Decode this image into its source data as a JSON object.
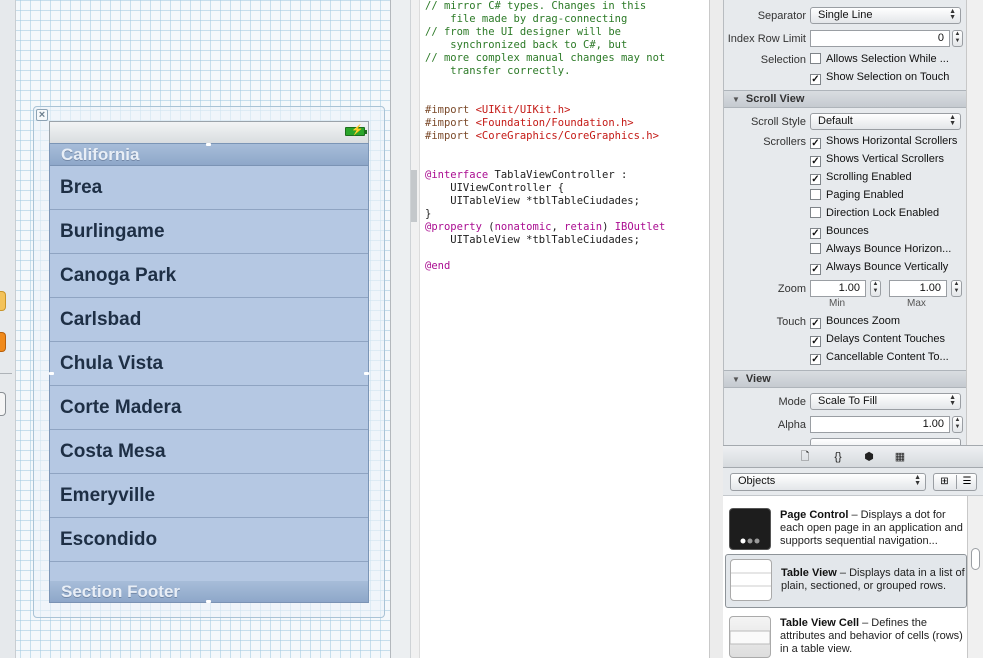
{
  "canvas": {
    "table": {
      "section_header": "California",
      "cells": [
        "Brea",
        "Burlingame",
        "Canoga Park",
        "Carlsbad",
        "Chula Vista",
        "Corte Madera",
        "Costa Mesa",
        "Emeryville",
        "Escondido"
      ],
      "section_footer": "Section Footer"
    },
    "close_glyph": "×",
    "battery_glyph": "⚡"
  },
  "code": {
    "lines": [
      [
        {
          "t": "// mirror C# types. Changes in this",
          "c": "comment"
        }
      ],
      [
        {
          "t": "    file made by drag-connecting",
          "c": "comment"
        }
      ],
      [
        {
          "t": "// from the UI designer will be",
          "c": "comment"
        }
      ],
      [
        {
          "t": "    synchronized back to C#, but",
          "c": "comment"
        }
      ],
      [
        {
          "t": "// more complex manual changes may not",
          "c": "comment"
        }
      ],
      [
        {
          "t": "    transfer correctly.",
          "c": "comment"
        }
      ],
      [
        {
          "t": "",
          "c": ""
        }
      ],
      [
        {
          "t": "",
          "c": ""
        }
      ],
      [
        {
          "t": "#import ",
          "c": "pre"
        },
        {
          "t": "<UIKit/UIKit.h>",
          "c": "str"
        }
      ],
      [
        {
          "t": "#import ",
          "c": "pre"
        },
        {
          "t": "<Foundation/Foundation.h>",
          "c": "str"
        }
      ],
      [
        {
          "t": "#import ",
          "c": "pre"
        },
        {
          "t": "<CoreGraphics/CoreGraphics.h>",
          "c": "str"
        }
      ],
      [
        {
          "t": "",
          "c": ""
        }
      ],
      [
        {
          "t": "",
          "c": ""
        }
      ],
      [
        {
          "t": "@interface",
          "c": "kw"
        },
        {
          "t": " TablaViewController :",
          "c": ""
        }
      ],
      [
        {
          "t": "    UIViewController {",
          "c": ""
        }
      ],
      [
        {
          "t": "    UITableView *tblTableCiudades;",
          "c": ""
        }
      ],
      [
        {
          "t": "}",
          "c": ""
        }
      ],
      [
        {
          "t": "@property",
          "c": "kw"
        },
        {
          "t": " (",
          "c": ""
        },
        {
          "t": "nonatomic",
          "c": "kw"
        },
        {
          "t": ", ",
          "c": ""
        },
        {
          "t": "retain",
          "c": "kw"
        },
        {
          "t": ") ",
          "c": ""
        },
        {
          "t": "IBOutlet",
          "c": "kw"
        }
      ],
      [
        {
          "t": "    UITableView *tblTableCiudades;",
          "c": ""
        }
      ],
      [
        {
          "t": "",
          "c": ""
        }
      ],
      [
        {
          "t": "@end",
          "c": "kw"
        }
      ]
    ]
  },
  "inspector": {
    "table_view": {
      "separator_label": "Separator",
      "separator_value": "Single Line",
      "index_row_limit_label": "Index Row Limit",
      "index_row_limit_value": "0",
      "selection_label": "Selection",
      "allows_selection_while": "Allows Selection While ...",
      "show_selection_on_touch": "Show Selection on Touch"
    },
    "scroll_view": {
      "title": "Scroll View",
      "scroll_style_label": "Scroll Style",
      "scroll_style_value": "Default",
      "scrollers_label": "Scrollers",
      "checks": [
        {
          "label": "Shows Horizontal Scrollers",
          "checked": true
        },
        {
          "label": "Shows Vertical Scrollers",
          "checked": true
        },
        {
          "label": "Scrolling Enabled",
          "checked": true
        },
        {
          "label": "Paging Enabled",
          "checked": false
        },
        {
          "label": "Direction Lock Enabled",
          "checked": false
        },
        {
          "label": "Bounces",
          "checked": true
        },
        {
          "label": "Always Bounce Horizon...",
          "checked": false
        },
        {
          "label": "Always Bounce Vertically",
          "checked": true
        }
      ],
      "zoom_label": "Zoom",
      "zoom_min": "1.00",
      "zoom_max": "1.00",
      "min_label": "Min",
      "max_label": "Max",
      "touch_label": "Touch",
      "touch_checks": [
        {
          "label": "Bounces Zoom",
          "checked": true
        },
        {
          "label": "Delays Content Touches",
          "checked": true
        },
        {
          "label": "Cancellable Content To...",
          "checked": true
        }
      ]
    },
    "view": {
      "title": "View",
      "mode_label": "Mode",
      "mode_value": "Scale To Fill",
      "alpha_label": "Alpha",
      "alpha_value": "1.00"
    }
  },
  "library": {
    "tabs": [
      "file-icon",
      "braces-icon",
      "cube-icon",
      "media-icon"
    ],
    "tab_glyphs": [
      "🗋",
      "{}",
      "⬢",
      "▦"
    ],
    "filter_value": "Objects",
    "items": [
      {
        "title": "Page Control",
        "desc": " – Displays a dot for each open page in an application and supports sequential navigation..."
      },
      {
        "title": "Table View",
        "desc": " – Displays data in a list of plain, sectioned, or grouped rows."
      },
      {
        "title": "Table View Cell",
        "desc": " – Defines the attributes and behavior of cells (rows) in a table view."
      }
    ]
  },
  "glyphs": {
    "check": "✓",
    "triangle_down": "▼",
    "updown": "▲\n▼",
    "grid_icon": "⊞",
    "list_icon": "☰"
  }
}
